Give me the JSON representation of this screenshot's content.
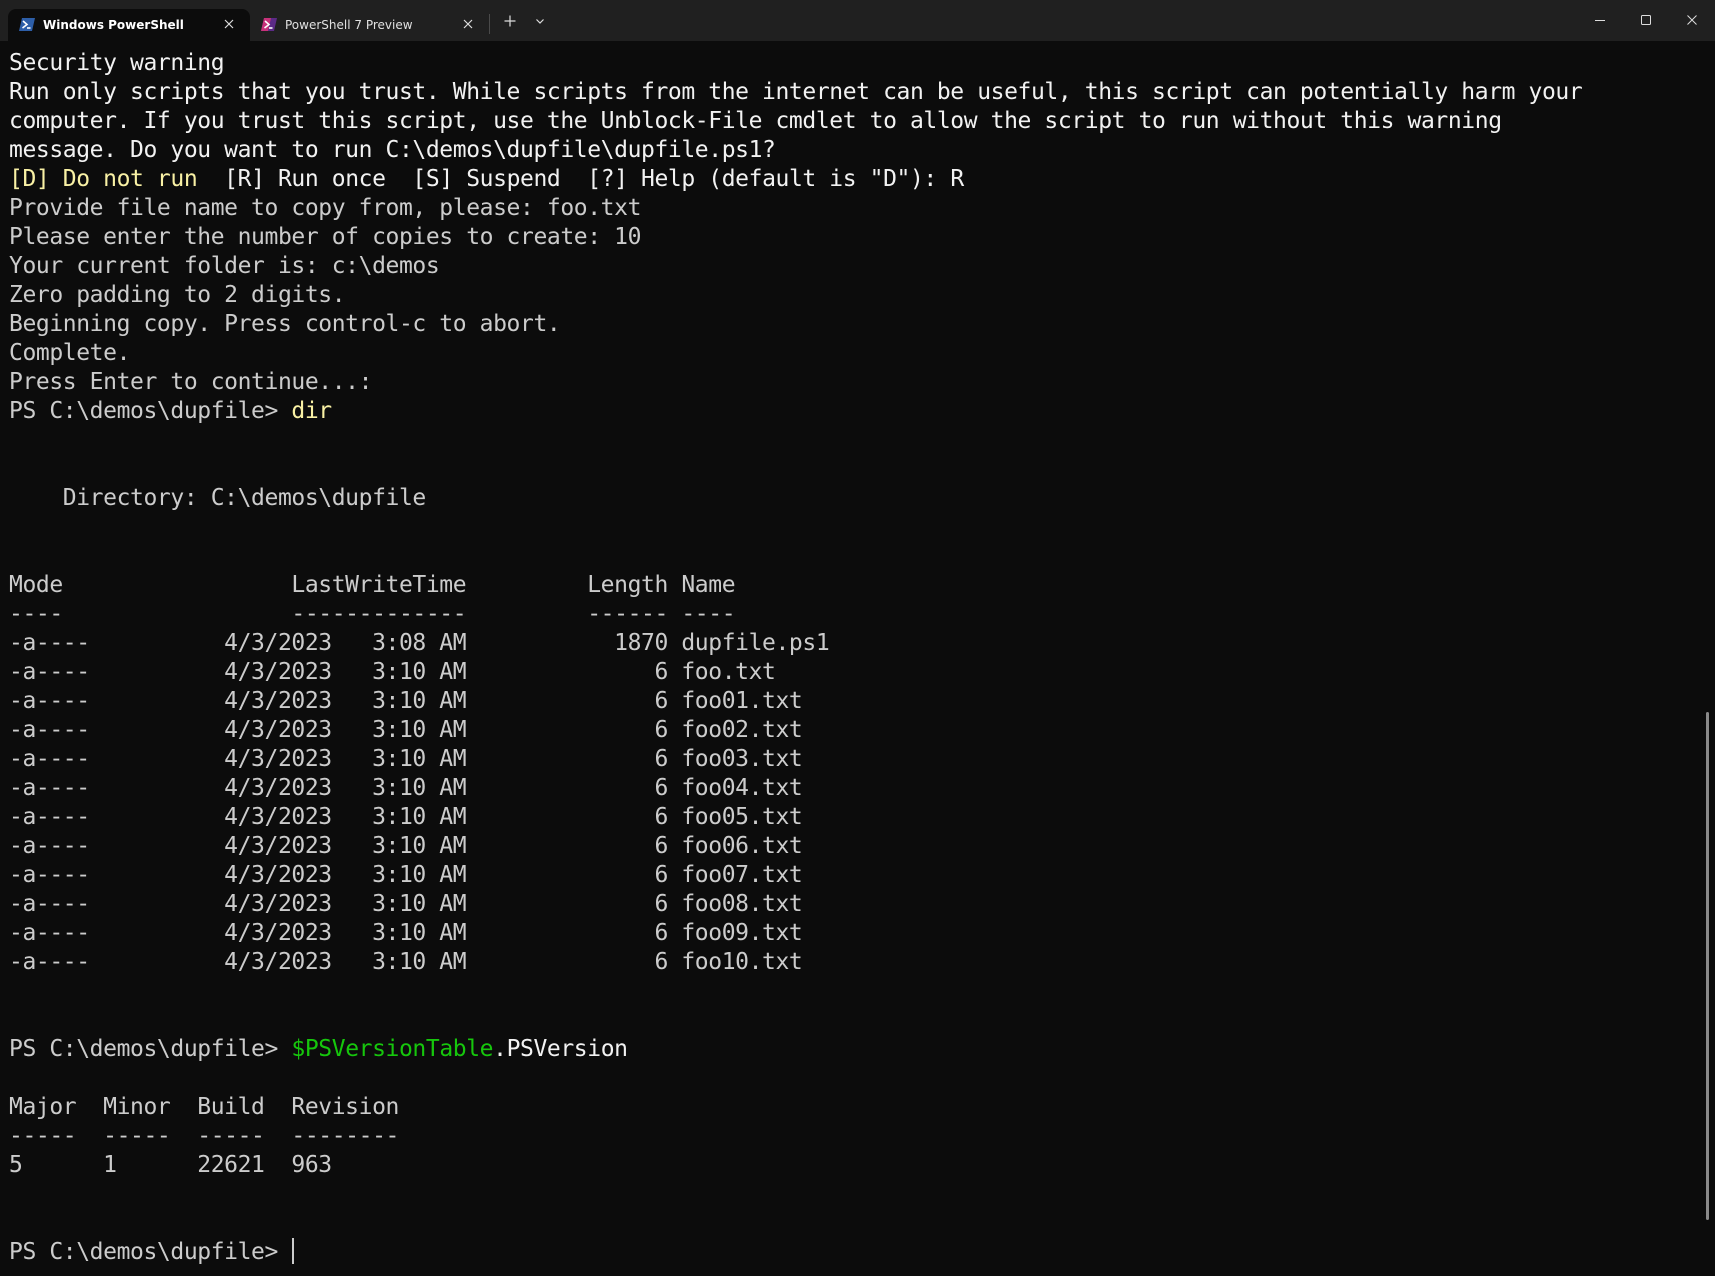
{
  "tabs": [
    {
      "label": "Windows PowerShell",
      "icon": "powershell-icon",
      "active": true
    },
    {
      "label": "PowerShell 7 Preview",
      "icon": "powershell-preview-icon",
      "active": false
    }
  ],
  "toolbar": {
    "new_tab_icon": "plus-icon",
    "dropdown_icon": "chevron-down-icon"
  },
  "window_controls": {
    "minimize_icon": "minimize-icon",
    "maximize_icon": "maximize-icon",
    "close_icon": "close-icon"
  },
  "colors": {
    "background": "#0c0c0c",
    "titlebar": "#202020",
    "text": "#cccccc",
    "bright_text": "#f2f2f2",
    "yellow": "#f9f1a5",
    "green": "#16c60c"
  },
  "terminal": {
    "security_title": "Security warning",
    "warning_lines": [
      "Run only scripts that you trust. While scripts from the internet can be useful, this script can potentially harm your",
      "computer. If you trust this script, use the Unblock-File cmdlet to allow the script to run without this warning",
      "message. Do you want to run C:\\demos\\dupfile\\dupfile.ps1?"
    ],
    "choice_default": "[D] Do not run",
    "choice_sep": "  ",
    "choice_options": "[R] Run once  [S] Suspend",
    "choice_help": "  [?] Help (default is \"D\"): R",
    "output_lines": [
      "Provide file name to copy from, please: foo.txt",
      "Please enter the number of copies to create: 10",
      "Your current folder is: c:\\demos",
      "Zero padding to 2 digits.",
      "Beginning copy. Press control-c to abort.",
      "Complete.",
      "Press Enter to continue...:"
    ],
    "prompt": "PS C:\\demos\\dupfile> ",
    "dir_command": "dir",
    "directory_line": "    Directory: C:\\demos\\dupfile",
    "dir_header": "Mode                 LastWriteTime         Length Name",
    "dir_underline": "----                 -------------         ------ ----",
    "dir_rows": [
      "-a----          4/3/2023   3:08 AM           1870 dupfile.ps1",
      "-a----          4/3/2023   3:10 AM              6 foo.txt",
      "-a----          4/3/2023   3:10 AM              6 foo01.txt",
      "-a----          4/3/2023   3:10 AM              6 foo02.txt",
      "-a----          4/3/2023   3:10 AM              6 foo03.txt",
      "-a----          4/3/2023   3:10 AM              6 foo04.txt",
      "-a----          4/3/2023   3:10 AM              6 foo05.txt",
      "-a----          4/3/2023   3:10 AM              6 foo06.txt",
      "-a----          4/3/2023   3:10 AM              6 foo07.txt",
      "-a----          4/3/2023   3:10 AM              6 foo08.txt",
      "-a----          4/3/2023   3:10 AM              6 foo09.txt",
      "-a----          4/3/2023   3:10 AM              6 foo10.txt"
    ],
    "version_var": "$PSVersionTable",
    "version_prop": ".PSVersion",
    "version_header": "Major  Minor  Build  Revision",
    "version_underline": "-----  -----  -----  --------",
    "version_row": "5      1      22621  963"
  }
}
